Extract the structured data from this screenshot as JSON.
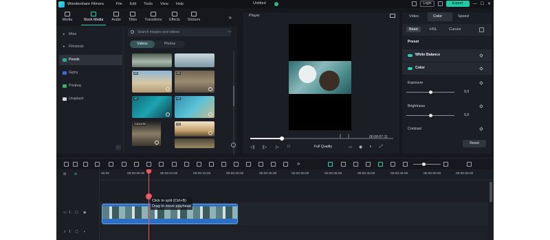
{
  "titlebar": {
    "app_name": "Wondershare Filmora",
    "menu": [
      "File",
      "Edit",
      "Tools",
      "View",
      "Help"
    ],
    "project_title": "Untitled",
    "login_label": "Login",
    "export_label": "Export"
  },
  "media_tabs": [
    {
      "label": "Media"
    },
    {
      "label": "Stock Media"
    },
    {
      "label": "Audio"
    },
    {
      "label": "Titles"
    },
    {
      "label": "Transitions"
    },
    {
      "label": "Effects"
    },
    {
      "label": "Stickers"
    }
  ],
  "sources": [
    {
      "label": "Mine"
    },
    {
      "label": "Filmstock"
    },
    {
      "label": "Pexels"
    },
    {
      "label": "Giphy"
    },
    {
      "label": "Pixabay"
    },
    {
      "label": "Unsplash"
    }
  ],
  "search": {
    "placeholder": "Search images and videos"
  },
  "media_type": {
    "videos": "Videos",
    "photos": "Photos"
  },
  "thumb_tags": {
    "hd": "HD",
    "k2": "2160x4096"
  },
  "player": {
    "title": "Player",
    "timecode": "00:00:07:11",
    "quality": "Full Quality"
  },
  "props": {
    "tabs": [
      "Video",
      "Color",
      "Speed"
    ],
    "subtabs": [
      "Basic",
      "HSL",
      "Curves"
    ],
    "preset_label": "Preset",
    "white_balance": "White Balance",
    "color": "Color",
    "exposure": "Exposure",
    "exposure_value": "0,0",
    "brightness": "Brightness",
    "brightness_value": "0,0",
    "contrast": "Contrast",
    "reset_label": "Reset"
  },
  "ruler_labels": [
    "00:00",
    "00:00:05:00",
    "00:00:10:00",
    "00:00:15:00",
    "00:00:20:00",
    "00:00:25:00",
    "00:00:30:00",
    "00:00:35:00",
    "00:00:40:00",
    "00:00:45:00",
    "00:00:50:00",
    "00:00:55:00"
  ],
  "tooltip": {
    "line1": "Click to split (Ctrl+B)",
    "line2": "Drag to move playhead"
  },
  "tracks": {
    "video": "1",
    "audio": "1"
  },
  "colors": {
    "accent": "#1fc9a4",
    "playhead": "#ef5a6a",
    "clip": "#2d6fc4"
  }
}
